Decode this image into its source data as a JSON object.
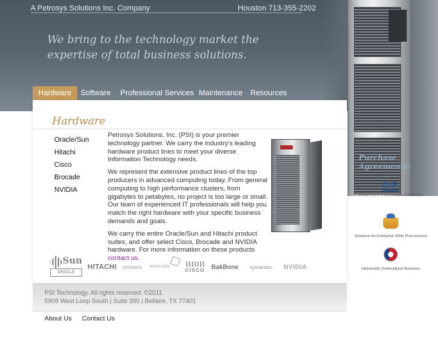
{
  "header": {
    "company": "A Petrosys Solutions Inc. Company",
    "phone": "Houston 713-355-2202",
    "tagline": "We bring to the technology market the expertise of total business solutions."
  },
  "nav": {
    "items": [
      "Hardware",
      "Software",
      "Professional Services",
      "Maintenance",
      "Resources"
    ],
    "active": "Hardware"
  },
  "page": {
    "title": "Hardware",
    "side_links": [
      "Oracle/Sun",
      "Hitachi",
      "Cisco",
      "Brocade",
      "NVIDIA"
    ],
    "paragraphs": [
      "Petrosys Solutions, Inc. (PSI) is your premier technology partner. We carry the industry's leading hardware product lines to meet your diverse Information Technology needs.",
      "We represent the extensive product lines of the top producers in advanced computing today. From general computing to high performance clusters, from gigabytes to petabytes, no project is too large or small. Our team of experienced IT professionals will help you match the right hardware with your specific business demands and goals.",
      "We carry the entire Oracle/Sun and Hitachi product suites, and offer select Cisco, Brocade and NVIDIA hardware. For more information on these products "
    ],
    "contact_link": "contact us",
    "contact_suffix": "."
  },
  "partner_logos": {
    "sun": "Sun",
    "oracle": "ORACLE",
    "hitachi": "HITACHI",
    "vmware": "vmware",
    "brocade": "BROCADE",
    "cisco": "CISCO",
    "bakbone": "BakBone",
    "symantec": "symantec.",
    "nvidia": "NVIDIA"
  },
  "footer": {
    "copyright_line1": "PSI Technology. All rights reserved. ©2011",
    "copyright_line2": "5909 West Loop South | Suite 390 | Bellaire, TX 77401",
    "links": [
      "About Us",
      "Contact Us"
    ]
  },
  "sidebar": {
    "title": "Purchase Agreements:",
    "items": [
      {
        "logo_text": "DIR",
        "caption": "Department of Information Resources"
      },
      {
        "caption": "Solutions for Enterprise Wide Procurement"
      },
      {
        "caption": "Historically Underutilized Business"
      }
    ]
  },
  "colors": {
    "accent_gold": "#c59b5b",
    "header_slate": "#56646f",
    "link_purple": "#8a2b8a",
    "sidebar_title": "#95abc0"
  },
  "icons": [
    "server-tower-image",
    "product-server-image",
    "dir-logo",
    "procurement-bucket-icon",
    "texas-hub-seal-icon"
  ]
}
